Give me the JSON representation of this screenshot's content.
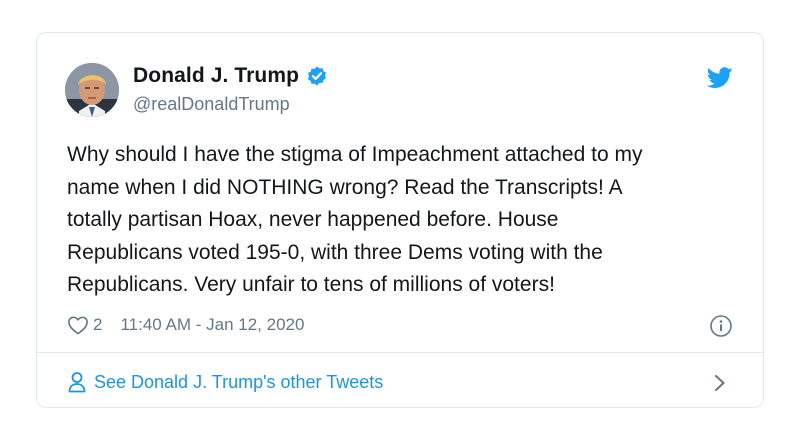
{
  "tweet": {
    "author": {
      "display_name": "Donald J. Trump",
      "handle": "@realDonaldTrump",
      "verified": true
    },
    "text": "Why should I have the stigma of Impeachment attached to my\nname when I did NOTHING wrong? Read the Transcripts! A\ntotally partisan Hoax, never happened before. House\nRepublicans voted 195-0, with three Dems voting with the\nRepublicans. Very unfair to tens of millions of voters!",
    "likes": "2",
    "timestamp": "11:40 AM - Jan 12, 2020",
    "footer_link": "See Donald J. Trump's other Tweets"
  },
  "icons": {
    "brand": "twitter-bird-icon",
    "verified": "verified-badge-icon",
    "like": "heart-icon",
    "info": "info-icon",
    "profile": "person-icon",
    "more": "chevron-right-icon"
  },
  "colors": {
    "accent": "#1da1f2",
    "link": "#1b95e0",
    "text": "#14171a",
    "muted": "#657786",
    "border": "#e1e8ed"
  }
}
